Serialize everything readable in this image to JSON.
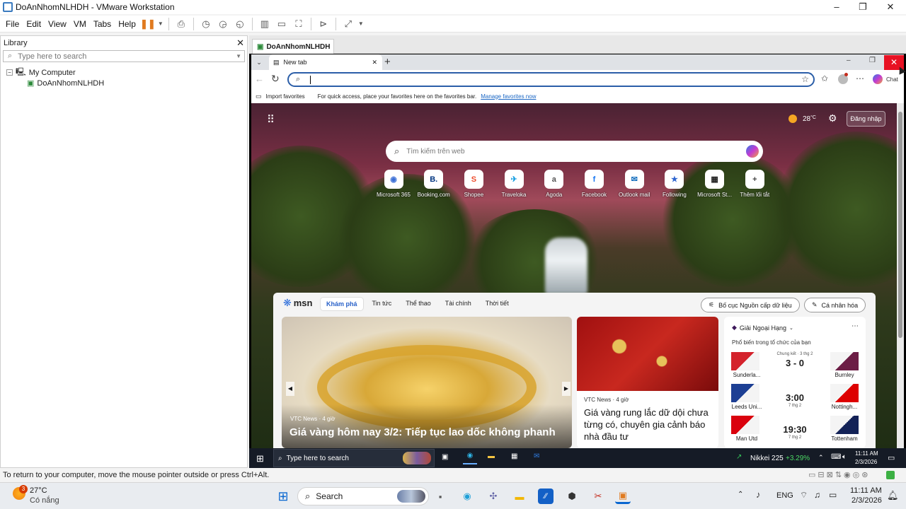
{
  "vmware": {
    "title": "DoAnNhomNLHDH - VMware Workstation",
    "menu": [
      "File",
      "Edit",
      "View",
      "VM",
      "Tabs",
      "Help"
    ],
    "library": {
      "title": "Library",
      "search_placeholder": "Type here to search",
      "root": "My Computer",
      "vm": "DoAnNhomNLHDH"
    },
    "vm_tab": "DoAnNhomNLHDH",
    "status": "To return to your computer, move the mouse pointer outside or press Ctrl+Alt."
  },
  "edge": {
    "tab_title": "New tab",
    "chat_label": "Chat",
    "favorites": {
      "import": "Import favorites",
      "hint": "For quick access, place your favorites here on the favorites bar.",
      "manage": "Manage favorites now"
    },
    "weather": "28",
    "weather_unit": "°C",
    "signin": "Đăng nhập",
    "search_placeholder": "Tìm kiếm trên web",
    "shortcuts": [
      {
        "label": "Microsoft 365",
        "glyph": "◉",
        "color": "#3b6fd6"
      },
      {
        "label": "Booking.com",
        "glyph": "B.",
        "color": "#003580"
      },
      {
        "label": "Shopee",
        "glyph": "S",
        "color": "#ee4d2d"
      },
      {
        "label": "Traveloka",
        "glyph": "✈",
        "color": "#1ba0e2"
      },
      {
        "label": "Agoda",
        "glyph": "a",
        "color": "#555"
      },
      {
        "label": "Facebook",
        "glyph": "f",
        "color": "#1877f2"
      },
      {
        "label": "Outlook mail",
        "glyph": "✉",
        "color": "#0f6cbd"
      },
      {
        "label": "Following",
        "glyph": "★",
        "color": "#2f66d0"
      },
      {
        "label": "Microsoft St...",
        "glyph": "▦",
        "color": "#222"
      },
      {
        "label": "Thêm lối tắt",
        "glyph": "+",
        "color": "#444"
      }
    ],
    "msn": {
      "logo": "msn",
      "nav": [
        "Khám phá",
        "Tin tức",
        "Thể thao",
        "Tài chính",
        "Thời tiết"
      ],
      "layout_btn": "Bố cục Nguồn cấp dữ liệu",
      "personalize_btn": "Cá nhân hóa",
      "main_story": {
        "source": "VTC News · 4 giờ",
        "headline": "Giá vàng hôm nay 3/2: Tiếp tục lao dốc không phanh"
      },
      "side_story": {
        "source": "VTC News · 4 giờ",
        "headline": "Giá vàng rung lắc dữ dội chưa từng có, chuyên gia cảnh báo nhà đầu tư"
      },
      "sports": {
        "league": "Giải Ngoại Hạng",
        "subtitle": "Phổ biến trong tổ chức của bạn",
        "matches": [
          {
            "home": "Sunderla...",
            "away": "Burnley",
            "center": "3 - 0",
            "note": "Chung kết · 3 thg 2",
            "home_color": "#d4232c",
            "away_color": "#6c1d45"
          },
          {
            "home": "Leeds Uni...",
            "away": "Nottingh...",
            "center": "3:00",
            "note": "7 thg 2",
            "home_color": "#1d3f94",
            "away_color": "#dd0000"
          },
          {
            "home": "Man Utd",
            "away": "Tottenham",
            "center": "19:30",
            "note": "7 thg 2",
            "home_color": "#da020e",
            "away_color": "#132257"
          }
        ]
      }
    }
  },
  "guest_taskbar": {
    "search": "Type here to search",
    "stock_name": "Nikkei 225",
    "stock_change": "+3.29%",
    "time": "11:11 AM",
    "date": "2/3/2026"
  },
  "host_taskbar": {
    "weather_temp": "27°C",
    "weather_desc": "Có nắng",
    "badge": "3",
    "search": "Search",
    "lang": "ENG",
    "time": "11:11 AM",
    "date": "2/3/2026"
  }
}
